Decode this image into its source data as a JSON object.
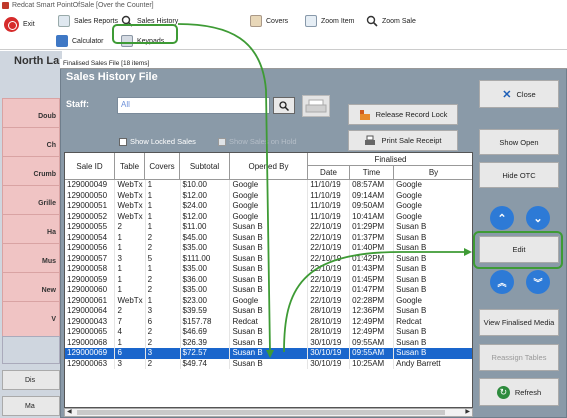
{
  "app": {
    "title": "Redcat Smart PointOfSale [Over the Counter]"
  },
  "toolbar": {
    "exit": "Exit",
    "sales_reports": "Sales Reports",
    "sales_history": "Sales History",
    "covers": "Covers",
    "zoom_item": "Zoom Item",
    "zoom_sale": "Zoom Sale",
    "calculator": "Calculator",
    "keypads": "Keypads"
  },
  "background": {
    "title": "North La",
    "pink_buttons": [
      "Doub",
      "Ch",
      "Crumb",
      "Grille",
      "Ha",
      "Mus",
      "New",
      "V"
    ],
    "bottom_items": [
      "Dis",
      "Ma"
    ]
  },
  "dialog": {
    "window_title": "Finalised Sales File [18 items]",
    "heading": "Sales History File",
    "staff_label": "Staff:",
    "staff_value": "All",
    "release_lock": "Release Record Lock",
    "print_receipt": "Print Sale Receipt",
    "show_locked": "Show Locked Sales",
    "show_on_hold": "Show Sales on Hold",
    "close": "Close",
    "show_open": "Show Open",
    "hide_otc": "Hide OTC",
    "edit": "Edit",
    "view_finalised_media": "View Finalised Media",
    "reassign_tables": "Reassign Tables",
    "refresh": "Refresh"
  },
  "grid": {
    "headers": {
      "sale_id": "Sale ID",
      "table": "Table",
      "covers": "Covers",
      "subtotal": "Subtotal",
      "opened_by": "Opened By",
      "finalised": "Finalised",
      "date": "Date",
      "time": "Time",
      "by": "By"
    },
    "rows": [
      [
        "129000049",
        "WebTx",
        "1",
        "$10.00",
        "Google",
        "11/10/19",
        "08:57AM",
        "Google"
      ],
      [
        "129000050",
        "WebTx",
        "1",
        "$12.00",
        "Google",
        "11/10/19",
        "09:14AM",
        "Google"
      ],
      [
        "129000051",
        "WebTx",
        "1",
        "$24.00",
        "Google",
        "11/10/19",
        "09:50AM",
        "Google"
      ],
      [
        "129000052",
        "WebTx",
        "1",
        "$12.00",
        "Google",
        "11/10/19",
        "10:41AM",
        "Google"
      ],
      [
        "129000055",
        "2",
        "1",
        "$11.00",
        "Susan B",
        "22/10/19",
        "01:29PM",
        "Susan B"
      ],
      [
        "129000054",
        "1",
        "2",
        "$45.00",
        "Susan B",
        "22/10/19",
        "01:37PM",
        "Susan B"
      ],
      [
        "129000056",
        "1",
        "2",
        "$35.00",
        "Susan B",
        "22/10/19",
        "01:40PM",
        "Susan B"
      ],
      [
        "129000057",
        "3",
        "5",
        "$111.00",
        "Susan B",
        "22/10/19",
        "01:42PM",
        "Susan B"
      ],
      [
        "129000058",
        "1",
        "1",
        "$35.00",
        "Susan B",
        "22/10/19",
        "01:43PM",
        "Susan B"
      ],
      [
        "129000059",
        "1",
        "2",
        "$36.00",
        "Susan B",
        "22/10/19",
        "01:45PM",
        "Susan B"
      ],
      [
        "129000060",
        "1",
        "2",
        "$35.00",
        "Susan B",
        "22/10/19",
        "01:47PM",
        "Susan B"
      ],
      [
        "129000061",
        "WebTx",
        "1",
        "$23.00",
        "Google",
        "22/10/19",
        "02:28PM",
        "Google"
      ],
      [
        "129000064",
        "2",
        "3",
        "$39.59",
        "Susan B",
        "28/10/19",
        "12:36PM",
        "Susan B"
      ],
      [
        "129000043",
        "7",
        "6",
        "$157.78",
        "Redcat",
        "28/10/19",
        "12:49PM",
        "Redcat"
      ],
      [
        "129000065",
        "4",
        "2",
        "$46.69",
        "Susan B",
        "28/10/19",
        "12:49PM",
        "Susan B"
      ],
      [
        "129000068",
        "1",
        "2",
        "$26.39",
        "Susan B",
        "30/10/19",
        "09:55AM",
        "Susan B"
      ],
      [
        "129000069",
        "6",
        "3",
        "$72.57",
        "Susan B",
        "30/10/19",
        "09:55AM",
        "Susan B"
      ],
      [
        "129000063",
        "3",
        "2",
        "$49.74",
        "Susan B",
        "30/10/19",
        "10:25AM",
        "Andy Barrett"
      ]
    ],
    "selected_index": 16
  },
  "colors": {
    "highlight": "#3e9b35",
    "selection": "#1a66cc",
    "dialog_bg": "#8a9aa8"
  }
}
